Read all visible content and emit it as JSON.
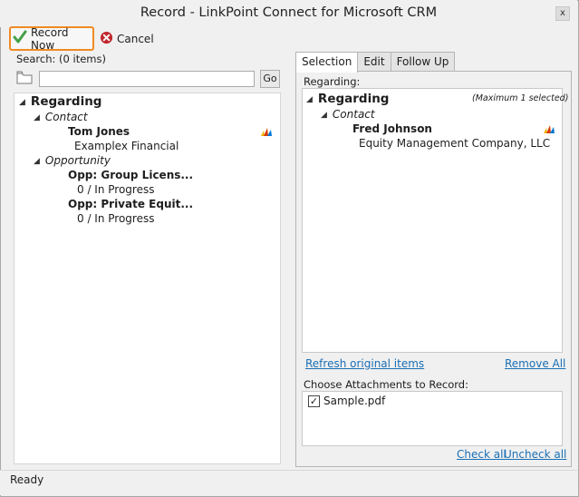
{
  "window": {
    "title": "Record - LinkPoint Connect for Microsoft CRM",
    "close_label": "x"
  },
  "toolbar": {
    "record_label": "Record Now",
    "cancel_label": "Cancel"
  },
  "search": {
    "label": "Search: (0 items)",
    "value": "",
    "go_label": "Go"
  },
  "left_tree": {
    "root": "Regarding",
    "groups": [
      {
        "name": "Contact",
        "items": [
          {
            "title": "Tom Jones",
            "sub": "Examplex Financial"
          }
        ]
      },
      {
        "name": "Opportunity",
        "items": [
          {
            "title": "Opp: Group Licens...",
            "sub": "0 / In Progress"
          },
          {
            "title": "Opp: Private Equit...",
            "sub": "0 / In Progress"
          }
        ]
      }
    ]
  },
  "tabs": [
    "Selection",
    "Edit",
    "Follow Up"
  ],
  "selection": {
    "regarding_label": "Regarding:",
    "root": "Regarding",
    "max_note": "(Maximum 1 selected)",
    "group": "Contact",
    "item_title": "Fred Johnson",
    "item_sub": "Equity Management Company, LLC",
    "refresh_link": "Refresh original items",
    "remove_all_link": "Remove All"
  },
  "attachments": {
    "label": "Choose Attachments to Record:",
    "items": [
      {
        "name": "Sample.pdf",
        "checked": true
      }
    ],
    "check_all": "Check all",
    "uncheck_all": "Uncheck all"
  },
  "status": {
    "text": "Ready"
  },
  "colors": {
    "highlight_border": "#f08a24",
    "link": "#1a6fb5",
    "cancel_icon": "#c0272d",
    "check_icon": "#43a047"
  }
}
